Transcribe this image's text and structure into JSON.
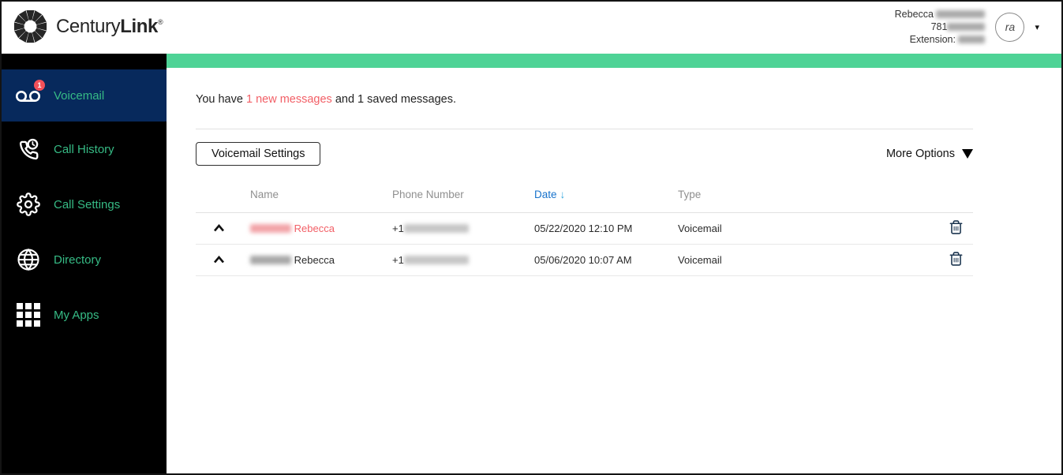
{
  "brand": {
    "name_regular": "Century",
    "name_bold": "Link",
    "trademark": "®"
  },
  "account": {
    "first_name": "Rebecca",
    "phone_prefix": "781",
    "extension_label": "Extension:",
    "avatar_initials": "ra",
    "caret": "▾"
  },
  "sidebar": {
    "items": [
      {
        "label": "Voicemail",
        "icon": "voicemail-icon",
        "badge": "1",
        "selected": true
      },
      {
        "label": "Call History",
        "icon": "call-history-icon"
      },
      {
        "label": "Call Settings",
        "icon": "call-settings-icon"
      },
      {
        "label": "Directory",
        "icon": "directory-icon"
      },
      {
        "label": "My Apps",
        "icon": "my-apps-icon"
      }
    ]
  },
  "main": {
    "summary": {
      "prefix": "You have",
      "highlight": "1 new messages",
      "suffix": "and 1 saved messages."
    },
    "toolbar": {
      "settings_button": "Voicemail Settings",
      "more_options": "More Options"
    },
    "table": {
      "headers": {
        "name": "Name",
        "phone": "Phone Number",
        "date": "Date",
        "type": "Type"
      },
      "sort": {
        "column": "Date",
        "direction": "desc",
        "arrow": "↓"
      },
      "rows": [
        {
          "name": "Rebecca",
          "phone_prefix": "+1",
          "date": "05/22/2020 12:10 PM",
          "type": "Voicemail",
          "state": "new"
        },
        {
          "name": "Rebecca",
          "phone_prefix": "+1",
          "date": "05/06/2020 10:07 AM",
          "type": "Voicemail",
          "state": "saved"
        }
      ]
    }
  },
  "colors": {
    "accent_green_bar": "#4ed396",
    "sidebar_link_green": "#36bb85",
    "selected_navy": "#07295c",
    "alert_red": "#f25f66",
    "sort_link_blue": "#1873cc",
    "sort_arrow_blue": "#2aa4dd"
  }
}
